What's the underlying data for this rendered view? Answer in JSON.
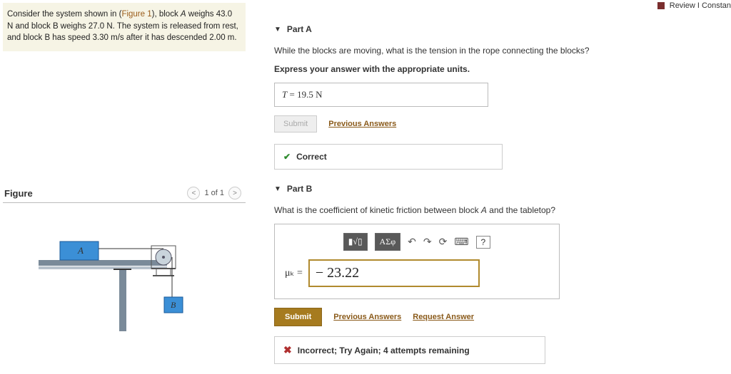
{
  "top": {
    "review": "Review",
    "constants": "Constan"
  },
  "problem": {
    "pre": "Consider the system shown in (",
    "figlink": "Figure 1",
    "post1": "), block ",
    "Aname": "A",
    "post2": " weighs 43.0 N and block ",
    "Bname": "B",
    "post3": " weighs 27.0 N. The system is released from rest, and block ",
    "Bname2": "B",
    "post4": " has speed 3.30 m/s after it has descended 2.00 m."
  },
  "figure": {
    "title": "Figure",
    "pager": "1 of 1",
    "A": "A",
    "B": "B"
  },
  "partA": {
    "title": "Part A",
    "question": "While the blocks are moving, what is the tension in the rope connecting the blocks?",
    "instruct": "Express your answer with the appropriate units.",
    "answer_var": "T",
    "answer_eq": " = ",
    "answer_val": "19.5 N",
    "submit": "Submit",
    "prev": "Previous Answers",
    "feedback": "Correct"
  },
  "partB": {
    "title": "Part B",
    "question_pre": "What is the coefficient of kinetic friction between block ",
    "A": "A",
    "question_post": " and the tabletop?",
    "tool_frac": "▮√▯",
    "tool_sym": "ΑΣφ",
    "tool_undo": "↶",
    "tool_redo": "↷",
    "tool_reset": "⟳",
    "tool_kb": "⌨",
    "tool_help": "?",
    "mu_label": "μₖ  =",
    "value": "− 23.22",
    "submit": "Submit",
    "prev": "Previous Answers",
    "req": "Request Answer",
    "feedback": "Incorrect; Try Again; 4 attempts remaining"
  }
}
